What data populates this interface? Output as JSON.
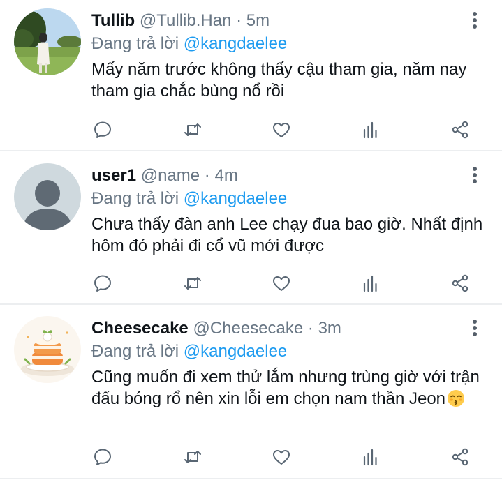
{
  "tweets": [
    {
      "name": "Tullib",
      "handle": "@Tullib.Han",
      "separator": "·",
      "time": "5m",
      "reply_prefix": "Đang trả lời",
      "reply_to": "@kangdaelee",
      "text": "Mấy năm trước không thấy cậu tham gia, năm nay tham gia chắc bùng nổ rồi",
      "avatar": "photo-person-in-park"
    },
    {
      "name": "user1",
      "handle": "@name",
      "separator": "·",
      "time": "4m",
      "reply_prefix": "Đang trả lời",
      "reply_to": "@kangdaelee",
      "text": "Chưa thấy đàn anh Lee chạy đua bao giờ. Nhất định hôm đó phải đi cổ vũ mới được",
      "avatar": "default-person-silhouette"
    },
    {
      "name": "Cheesecake",
      "handle": "@Cheesecake",
      "separator": "·",
      "time": "3m",
      "reply_prefix": "Đang trả lời",
      "reply_to": "@kangdaelee",
      "text": "Cũng muốn đi xem thử lắm nhưng trùng giờ với trận đấu bóng rổ nên xin lỗi em chọn nam thần Jeon",
      "emoji": "kissing-face-emoji",
      "avatar": "illustrated-cake"
    }
  ],
  "colors": {
    "text": "#0f1419",
    "secondary": "#687684",
    "mention": "#1d9bf0",
    "divider": "#eceef0"
  },
  "icons": [
    "more-vertical-icon",
    "reply-icon",
    "retweet-icon",
    "like-icon",
    "analytics-icon",
    "share-icon"
  ]
}
